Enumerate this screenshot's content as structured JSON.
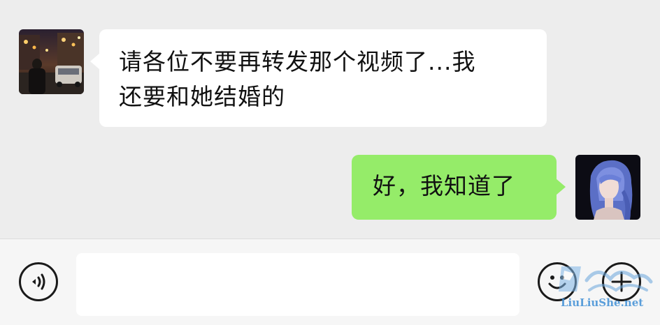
{
  "messages": [
    {
      "side": "left",
      "lines": [
        "请各位不要再转发那个视频了...我",
        "还要和她结婚的"
      ]
    },
    {
      "side": "right",
      "text": "好，我知道了"
    }
  ],
  "input": {
    "value": "",
    "placeholder": ""
  },
  "icons": {
    "voice": "voice-wave-icon",
    "emoji": "smiley-icon",
    "more": "plus-icon"
  },
  "colors": {
    "background": "#ededed",
    "incoming_bubble": "#ffffff",
    "outgoing_bubble": "#95ec69",
    "input_bar": "#f6f6f6",
    "watermark": "#3f8fd6"
  },
  "watermark": {
    "text": "LiuLiuShe.net"
  }
}
